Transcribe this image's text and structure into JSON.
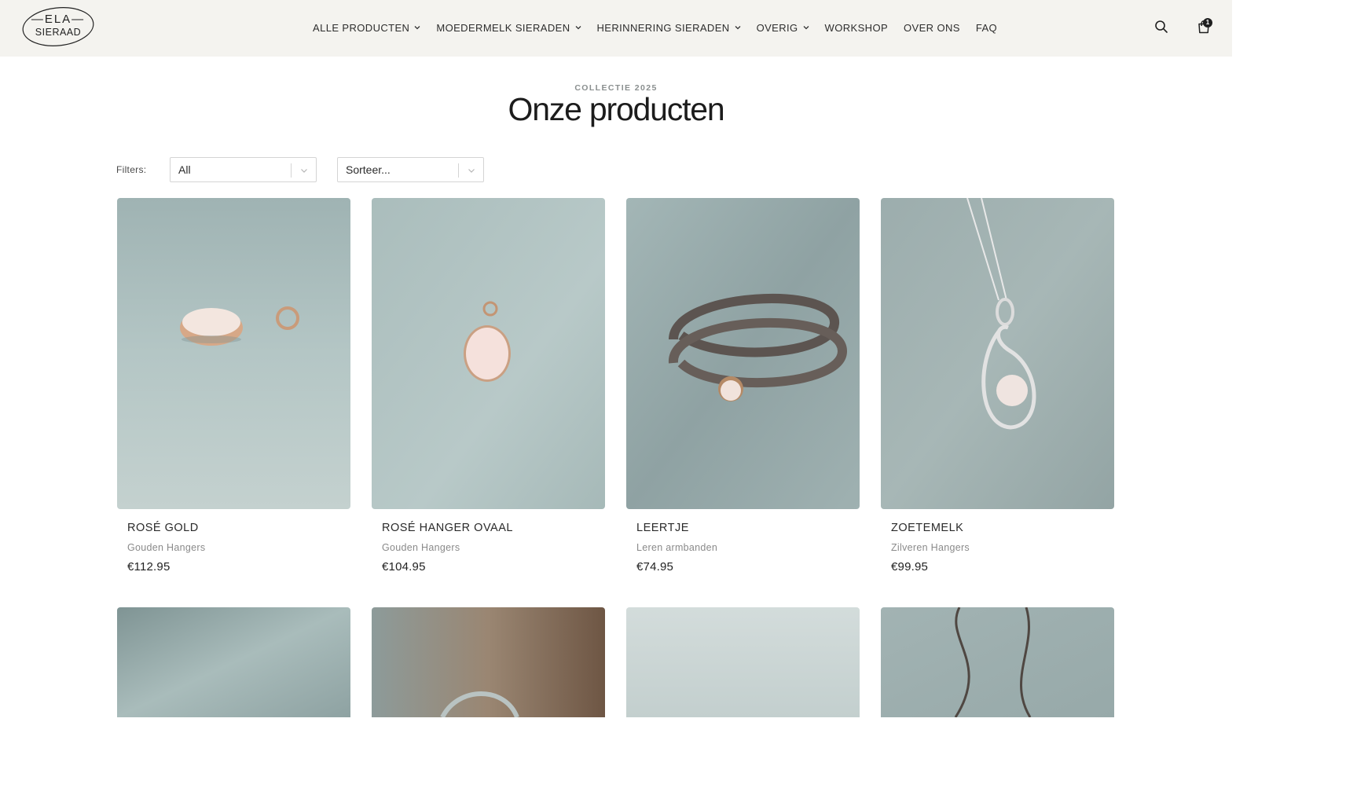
{
  "brand": {
    "line1": "—ELA—",
    "line2": "SIERAAD"
  },
  "nav": {
    "items": [
      {
        "label": "ALLE PRODUCTEN",
        "dropdown": true
      },
      {
        "label": "MOEDERMELK SIERADEN",
        "dropdown": true
      },
      {
        "label": "HERINNERING SIERADEN",
        "dropdown": true
      },
      {
        "label": "OVERIG",
        "dropdown": true
      },
      {
        "label": "WORKSHOP",
        "dropdown": false
      },
      {
        "label": "OVER ONS",
        "dropdown": false
      },
      {
        "label": "FAQ",
        "dropdown": false
      }
    ]
  },
  "header_icons": {
    "search": "search-icon",
    "cart": "shopping-bag-icon",
    "cart_count": "1"
  },
  "hero": {
    "eyebrow": "COLLECTIE 2025",
    "title": "Onze producten"
  },
  "filters": {
    "label": "Filters:",
    "filter_value": "All",
    "sort_value": "Sorteer..."
  },
  "products": [
    {
      "name": "ROSÉ GOLD",
      "category": "Gouden Hangers",
      "price": "€112.95"
    },
    {
      "name": "ROSÉ HANGER OVAAL",
      "category": "Gouden Hangers",
      "price": "€104.95"
    },
    {
      "name": "LEERTJE",
      "category": "Leren armbanden",
      "price": "€74.95"
    },
    {
      "name": "ZOETEMELK",
      "category": "Zilveren Hangers",
      "price": "€99.95"
    }
  ],
  "colors": {
    "header_bg": "#f4f3ef",
    "velvet": "#a9bcbc",
    "text": "#2b2b2b",
    "muted": "#8a8a8a"
  }
}
